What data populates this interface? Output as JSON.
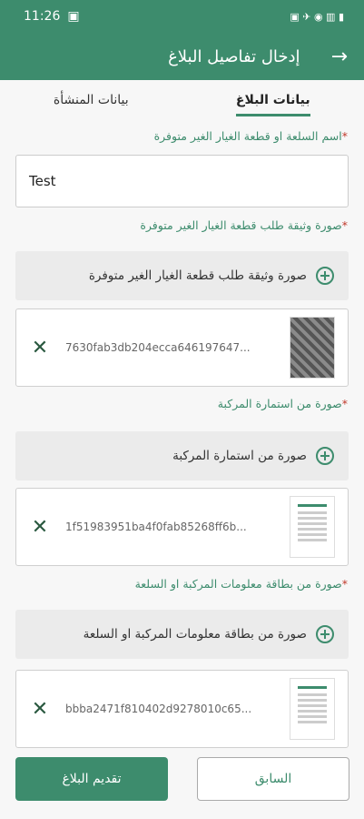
{
  "status_bar": {
    "time": "11:26",
    "icons": "▣ ✈ ◉ ▥ ▮"
  },
  "app_bar": {
    "title": "إدخال تفاصيل البلاغ",
    "back_icon": "arrow-right"
  },
  "tabs": [
    {
      "label": "بيانات المنشأة",
      "active": false
    },
    {
      "label": "بيانات البلاغ",
      "active": true
    }
  ],
  "form": {
    "item_label": "اسم السلعة او قطعة الغيار الغير متوفرة",
    "item_value": "Test",
    "doc_label": "صورة وثيقة طلب قطعة الغيار الغير متوفرة",
    "doc_button": "صورة وثيقة طلب قطعة الغيار الغير متوفرة",
    "doc_file": "7630fab3db204ecca646197647...",
    "reg_label": "صورة من استمارة المركبة",
    "reg_button": "صورة من استمارة المركبة",
    "reg_file": "1f51983951ba4f0fab85268ff6b...",
    "card_label": "صورة من بطاقة معلومات المركبة او السلعة",
    "card_button": "صورة من بطاقة معلومات المركبة او السلعة",
    "card_file": "bbba2471f810402d9278010c65..."
  },
  "buttons": {
    "submit": "تقديم البلاغ",
    "previous": "السابق"
  },
  "colors": {
    "primary": "#3d8c6d",
    "required": "#c0392b"
  }
}
